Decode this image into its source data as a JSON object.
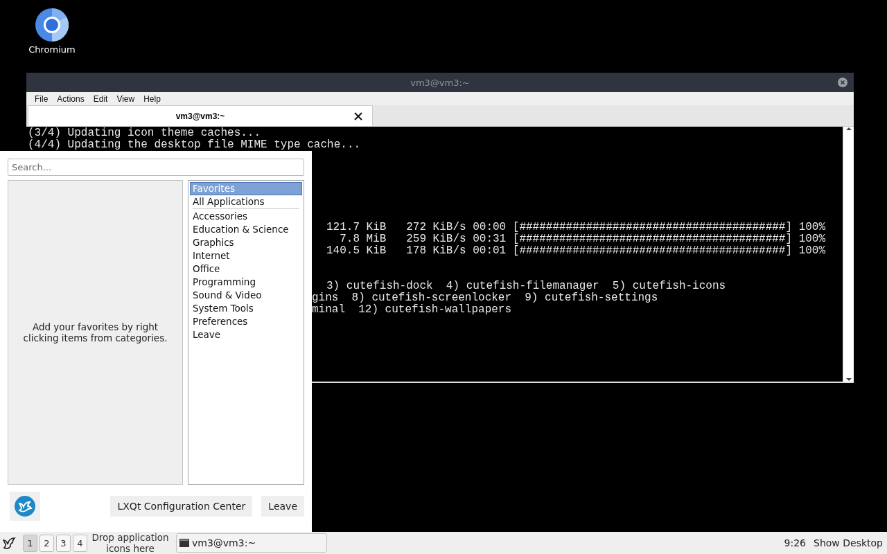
{
  "desktop_icons": [
    {
      "label": "Chromium"
    }
  ],
  "terminal": {
    "title": "vm3@vm3:~",
    "menu": [
      "File",
      "Actions",
      "Edit",
      "View",
      "Help"
    ],
    "tabs": [
      {
        "label": "vm3@vm3:~",
        "selected": true
      }
    ],
    "lines": [
      {
        "kind": "text",
        "text": "(3/4) Updating icon theme caches..."
      },
      {
        "kind": "text",
        "text": "(4/4) Updating the desktop file MIME type cache..."
      },
      {
        "kind": "blank"
      },
      {
        "kind": "blank"
      },
      {
        "kind": "blank"
      },
      {
        "kind": "blank"
      },
      {
        "kind": "blank"
      },
      {
        "kind": "blank"
      },
      {
        "kind": "progress",
        "size": "121.7 KiB",
        "speed": "272 KiB/s",
        "eta": "00:00",
        "bar": "[########################################]",
        "percent": "100%"
      },
      {
        "kind": "progress",
        "size": "7.8 MiB",
        "speed": "259 KiB/s",
        "eta": "00:31",
        "bar": "[########################################]",
        "percent": "100%"
      },
      {
        "kind": "progress",
        "size": "140.5 KiB",
        "speed": "178 KiB/s",
        "eta": "00:01",
        "bar": "[########################################]",
        "percent": "100%"
      },
      {
        "kind": "blank"
      },
      {
        "kind": "blank"
      },
      {
        "kind": "indented",
        "text": "3) cutefish-dock  4) cutefish-filemanager  5) cutefish-icons"
      },
      {
        "kind": "cut",
        "text": "gins  8) cutefish-screenlocker  9) cutefish-settings"
      },
      {
        "kind": "cut",
        "text": "minal  12) cutefish-wallpapers"
      }
    ]
  },
  "app_menu": {
    "search": {
      "placeholder": "Search..."
    },
    "favorites_hint": "Add your favorites by right clicking items from categories.",
    "categories": [
      {
        "label": "Favorites",
        "selected": true
      },
      {
        "label": "All Applications",
        "selected": false,
        "separator_after": true
      },
      {
        "label": "Accessories",
        "selected": false
      },
      {
        "label": "Education & Science",
        "selected": false
      },
      {
        "label": "Graphics",
        "selected": false
      },
      {
        "label": "Internet",
        "selected": false
      },
      {
        "label": "Office",
        "selected": false
      },
      {
        "label": "Programming",
        "selected": false
      },
      {
        "label": "Sound & Video",
        "selected": false
      },
      {
        "label": "System Tools",
        "selected": false
      },
      {
        "label": "Preferences",
        "selected": false
      },
      {
        "label": "Leave",
        "selected": false
      }
    ],
    "buttons": [
      "LXQt Configuration Center",
      "Leave"
    ]
  },
  "taskbar": {
    "desktops": [
      {
        "label": "1",
        "selected": true
      },
      {
        "label": "2",
        "selected": false
      },
      {
        "label": "3",
        "selected": false
      },
      {
        "label": "4",
        "selected": false
      }
    ],
    "quicklaunch_hint": "Drop application icons here",
    "tasks": [
      {
        "label": "vm3@vm3:~"
      }
    ],
    "clock": "9:26",
    "show_desktop": "Show Desktop"
  }
}
